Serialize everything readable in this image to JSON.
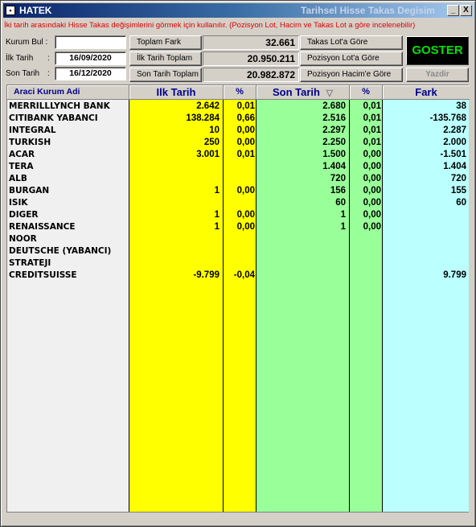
{
  "window": {
    "app_name": "HATEK",
    "title": "Tarihsel Hisse Takas Degisim",
    "minimize": "_",
    "close": "X"
  },
  "info_text": "İki tarih arasındaki Hisse Takas değişimlerini görmek için kullanılır. (Pozisyon Lot, Hacim ve Takas Lot a göre incelenebilir)",
  "form": {
    "kurum_bul_label": "Kurum Bul :",
    "kurum_bul_value": "",
    "ilk_tarih_label": "İlk Tarih",
    "ilk_tarih_value": "16/09/2020",
    "son_tarih_label": "Son Tarih",
    "son_tarih_value": "16/12/2020",
    "colon": ":"
  },
  "summary": {
    "toplam_fark_label": "Toplam Fark",
    "toplam_fark_value": "32.661",
    "ilk_tarih_toplam_label": "İlk Tarih Toplam",
    "ilk_tarih_toplam_value": "20.950.211",
    "son_tarih_toplam_label": "Son Tarih Toplam",
    "son_tarih_toplam_value": "20.982.872"
  },
  "buttons": {
    "takas_lot": "Takas Lot'a Göre",
    "pozisyon_lot": "Pozisyon Lot'a Göre",
    "pozisyon_hacim": "Pozisyon Hacim'e Göre",
    "goster": "GOSTER",
    "yazdir": "Yazdir"
  },
  "table": {
    "headers": {
      "kurum": "Araci Kurum Adi",
      "ilk_tarih": "Ilk Tarih",
      "pct1": "%",
      "son_tarih": "Son Tarih",
      "sort_icon": "▽",
      "pct2": "%",
      "fark": "Fark"
    },
    "column_colors": {
      "name": "#f0f0f0",
      "ilk": "#ffff00",
      "son": "#99ff99",
      "fark": "#bbffff"
    },
    "rows": [
      {
        "name": "MERRILLLYNCH BANK",
        "ilk": "2.642",
        "p1": "0,01",
        "son": "2.680",
        "p2": "0,01",
        "fark": "38"
      },
      {
        "name": "CITIBANK YABANCI",
        "ilk": "138.284",
        "p1": "0,66",
        "son": "2.516",
        "p2": "0,01",
        "fark": "-135.768"
      },
      {
        "name": "INTEGRAL",
        "ilk": "10",
        "p1": "0,00",
        "son": "2.297",
        "p2": "0,01",
        "fark": "2.287"
      },
      {
        "name": "TURKISH",
        "ilk": "250",
        "p1": "0,00",
        "son": "2.250",
        "p2": "0,01",
        "fark": "2.000"
      },
      {
        "name": "ACAR",
        "ilk": "3.001",
        "p1": "0,01",
        "son": "1.500",
        "p2": "0,00",
        "fark": "-1.501"
      },
      {
        "name": "TERA",
        "ilk": "",
        "p1": "",
        "son": "1.404",
        "p2": "0,00",
        "fark": "1.404"
      },
      {
        "name": "ALB",
        "ilk": "",
        "p1": "",
        "son": "720",
        "p2": "0,00",
        "fark": "720"
      },
      {
        "name": "BURGAN",
        "ilk": "1",
        "p1": "0,00",
        "son": "156",
        "p2": "0,00",
        "fark": "155"
      },
      {
        "name": "ISIK",
        "ilk": "",
        "p1": "",
        "son": "60",
        "p2": "0,00",
        "fark": "60"
      },
      {
        "name": "DIGER",
        "ilk": "1",
        "p1": "0,00",
        "son": "1",
        "p2": "0,00",
        "fark": ""
      },
      {
        "name": "RENAISSANCE",
        "ilk": "1",
        "p1": "0,00",
        "son": "1",
        "p2": "0,00",
        "fark": ""
      },
      {
        "name": "NOOR",
        "ilk": "",
        "p1": "",
        "son": "",
        "p2": "",
        "fark": ""
      },
      {
        "name": "DEUTSCHE (YABANCI)",
        "ilk": "",
        "p1": "",
        "son": "",
        "p2": "",
        "fark": ""
      },
      {
        "name": "STRATEJI",
        "ilk": "",
        "p1": "",
        "son": "",
        "p2": "",
        "fark": ""
      },
      {
        "name": "CREDITSUISSE",
        "ilk": "-9.799",
        "p1": "-0,04",
        "son": "",
        "p2": "",
        "fark": "9.799"
      }
    ]
  }
}
